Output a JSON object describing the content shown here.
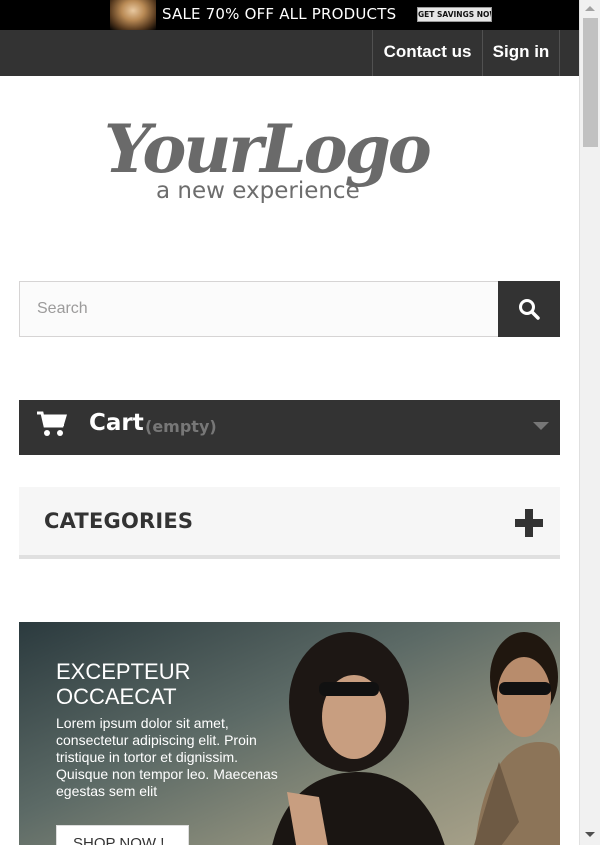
{
  "promo": {
    "text": "SALE 70% OFF ALL PRODUCTS",
    "button_label": "GET SAVINGS NOW"
  },
  "header": {
    "contact_label": "Contact us",
    "signin_label": "Sign in"
  },
  "logo": {
    "wordmark": "YourLogo",
    "tagline": "a new experience"
  },
  "search": {
    "placeholder": "Search",
    "value": "",
    "button_icon": "search-icon"
  },
  "cart": {
    "icon": "cart-icon",
    "label": "Cart",
    "status": "(empty)",
    "toggle_icon": "caret-down-icon"
  },
  "categories": {
    "title": "CATEGORIES",
    "toggle_icon": "plus-icon"
  },
  "slider": {
    "title": "EXCEPTEUR OCCAECAT",
    "text": "Lorem ipsum dolor sit amet, consectetur adipiscing elit. Proin tristique in tortor et dignissim. Quisque non tempor leo. Maecenas egestas sem elit",
    "button_label": "SHOP NOW !"
  },
  "colors": {
    "dark": "#333333",
    "promo_bg": "#000000",
    "light_panel": "#f6f6f6",
    "muted_text": "#777777"
  }
}
